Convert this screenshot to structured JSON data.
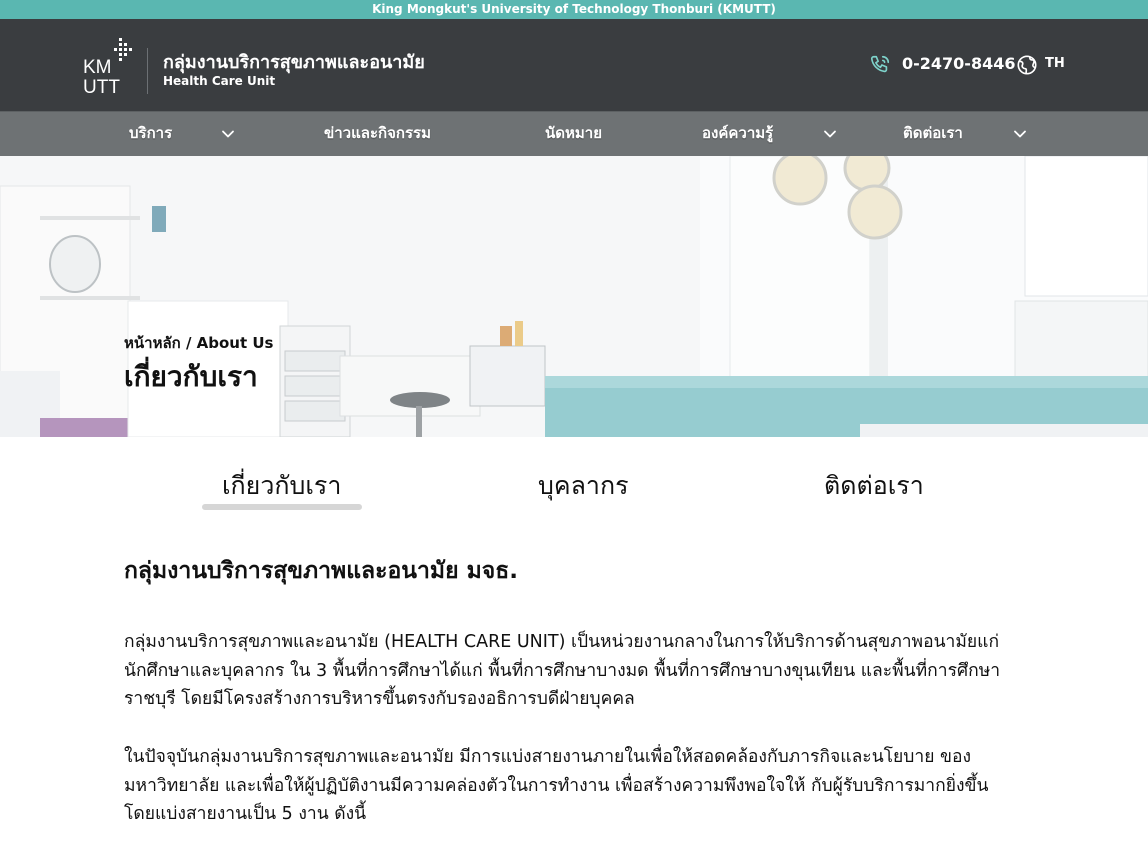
{
  "topbar": {
    "text": "King Mongkut's University of Technology Thonburi (KMUTT)"
  },
  "header": {
    "logo_text_top": "KM",
    "logo_text_bottom": "UTT",
    "title": "กลุ่มงานบริการสุขภาพและอนามัย",
    "subtitle": "Health Care Unit",
    "phone": "0-2470-8446",
    "language": "TH"
  },
  "nav": {
    "items": [
      {
        "label": "บริการ",
        "has_dropdown": true
      },
      {
        "label": "ข่าวและกิจกรรม",
        "has_dropdown": false
      },
      {
        "label": "นัดหมาย",
        "has_dropdown": false
      },
      {
        "label": "องค์ความรู้",
        "has_dropdown": true
      },
      {
        "label": "ติดต่อเรา",
        "has_dropdown": true
      }
    ]
  },
  "hero": {
    "breadcrumb": "หน้าหลัก / About Us",
    "title": "เกี่ยวกับเรา"
  },
  "tabs": [
    {
      "label": "เกี่ยวกับเรา",
      "active": true
    },
    {
      "label": "บุคลากร",
      "active": false
    },
    {
      "label": "ติดต่อเรา",
      "active": false
    }
  ],
  "content": {
    "heading": "กลุ่มงานบริการสุขภาพและอนามัย มจธ.",
    "paragraph1": "กลุ่มงานบริการสุขภาพและอนามัย (HEALTH CARE UNIT) เป็นหน่วยงานกลางในการให้บริการด้านสุขภาพอนามัยแก่นักศึกษาและบุคลากร ใน 3 พื้นที่การศึกษาได้แก่ พื้นที่การศึกษาบางมด พื้นที่การศึกษาบางขุนเทียน และพื้นที่การศึกษาราชบุรี โดยมีโครงสร้างการบริหารขึ้นตรงกับรองอธิการบดีฝ่ายบุคคล",
    "paragraph2": "ในปัจจุบันกลุ่มงานบริการสุขภาพและอนามัย มีการแบ่งสายงานภายในเพื่อให้สอดคล้องกับภารกิจและนโยบาย ของมหาวิทยาลัย และเพื่อให้ผู้ปฏิบัติงานมีความคล่องตัวในการทำงาน เพื่อสร้างความพึงพอใจให้ กับผู้รับบริการมากยิ่งขึ้น โดยแบ่งสายงานเป็น 5 งาน ดังนี้"
  },
  "colors": {
    "topbar": "#5ab7b1",
    "header": "#3a3d40",
    "nav": "#6e7274",
    "tab_underline": "#d6d6d6"
  },
  "icons": {
    "phone": "phone-icon",
    "language": "globe-icon",
    "dropdown": "chevron-down-icon"
  }
}
